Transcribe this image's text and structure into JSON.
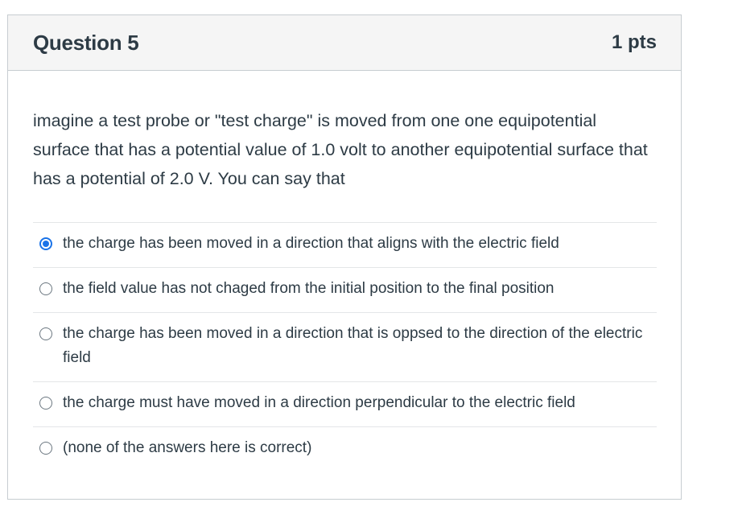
{
  "question": {
    "title": "Question 5",
    "points": "1 pts",
    "text": "imagine a test probe or \"test charge\" is moved from one one equipotential surface that has a potential value of 1.0 volt to another equipotential surface that has a potential of 2.0 V.  You can say that",
    "answers": [
      {
        "label": "the charge has been moved in a direction that aligns with the electric field",
        "selected": true
      },
      {
        "label": "the field value has not chaged from the initial position to the final position",
        "selected": false
      },
      {
        "label": "the charge has been moved in a direction that is oppsed to the direction of the electric field",
        "selected": false
      },
      {
        "label": "the charge must have moved in a direction perpendicular to the electric field",
        "selected": false
      },
      {
        "label": "(none of the answers here is correct)",
        "selected": false
      }
    ]
  },
  "colors": {
    "accent": "#1a73e8",
    "text": "#2d3b45",
    "header_bg": "#f5f5f5",
    "border": "#c7cdd1"
  }
}
